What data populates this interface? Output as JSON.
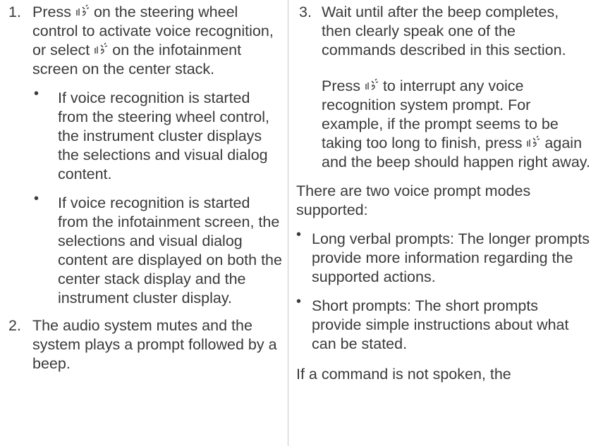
{
  "left": {
    "step1": {
      "num": "1.",
      "t1": "Press",
      "t2": "on the steering wheel control to activate voice recognition, or select",
      "t3": "on the infotainment screen on the center stack.",
      "bullets": [
        "If voice recognition is started from the steering wheel control, the instrument cluster displays the selections and visual dialog content.",
        "If voice recognition is started from the infotainment screen, the selections and visual dialog content are displayed on both the center stack display and the instrument cluster display."
      ]
    },
    "step2": {
      "num": "2.",
      "text": "The audio system mutes and the system plays a prompt followed by a beep."
    }
  },
  "right": {
    "step3": {
      "num": "3.",
      "text": "Wait until after the beep completes, then clearly speak one of the commands described in this section.",
      "p1": "Press",
      "p2": "to interrupt any voice recognition system prompt. For example, if the prompt seems to be taking too long to finish, press",
      "p3": "again and the beep should happen right away."
    },
    "modes_intro": "There are two voice prompt modes supported:",
    "modes": [
      "Long verbal prompts: The longer prompts provide more information regarding the supported actions.",
      "Short prompts: The short prompts provide simple instructions about what can be stated."
    ],
    "tail": "If a command is not spoken, the"
  },
  "bullet_char": "•",
  "icon_name": "voice-recognition-icon"
}
